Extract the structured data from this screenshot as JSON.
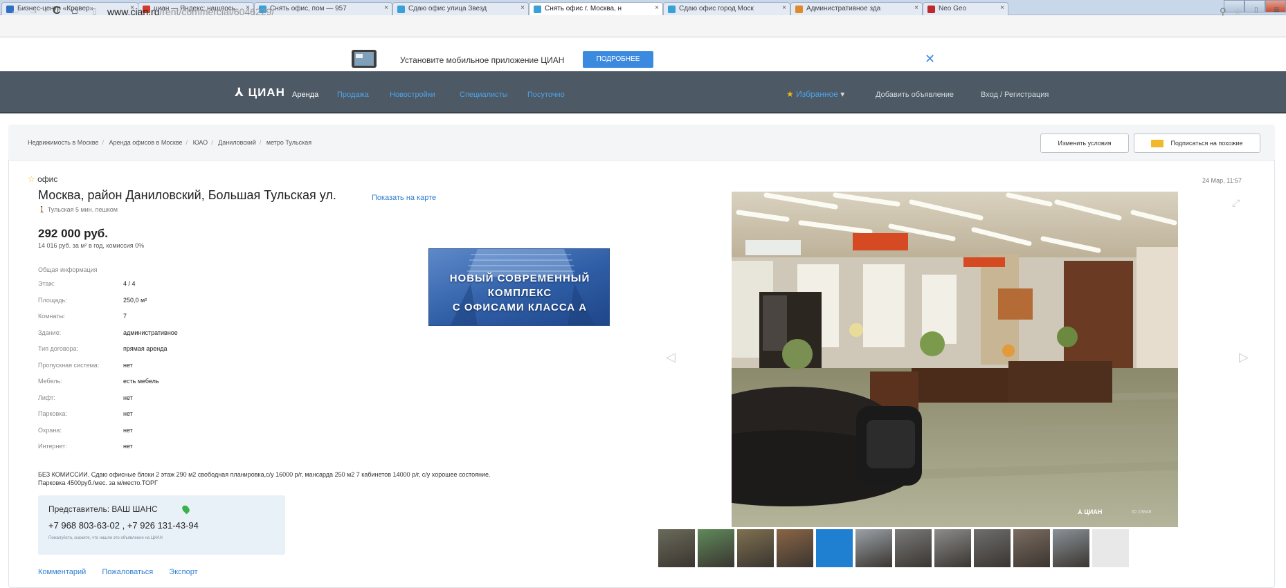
{
  "browser": {
    "tabs": [
      {
        "label": "Бизнес-центр «Кравер»",
        "color": "#2f6fc6",
        "active": false
      },
      {
        "label": "циан — Яндекс: нашлось",
        "color": "#d23a2a",
        "active": false
      },
      {
        "label": "Снять офис, пом — 957",
        "color": "#3aa0d8",
        "active": false
      },
      {
        "label": "Сдаю офис улица Звезд",
        "color": "#3aa0d8",
        "active": false
      },
      {
        "label": "Снять офис г. Москва, н",
        "color": "#3aa0d8",
        "active": true
      },
      {
        "label": "Сдаю офис город Моск",
        "color": "#3aa0d8",
        "active": false
      },
      {
        "label": "Административное зда",
        "color": "#e0892a",
        "active": false
      },
      {
        "label": "Neo Geo",
        "color": "#c0282a",
        "active": false
      }
    ],
    "url_host": "www.cian.ru",
    "url_path": "/rent/commercial/6046229/"
  },
  "promo": {
    "text": "Установите мобильное приложение ЦИАН",
    "button": "ПОДРОБНЕЕ",
    "close": "✕"
  },
  "header": {
    "logo": "ЦИАН",
    "nav_active": "Аренда",
    "nav": [
      "Продажа",
      "Новостройки",
      "Специалисты",
      "Посуточно"
    ],
    "favorites": "Избранное",
    "add_listing": "Добавить объявление",
    "login": "Вход / Регистрация"
  },
  "breadcrumbs": [
    "Недвижимость в Москве",
    "Аренда офисов в Москве",
    "ЮАО",
    "Даниловский",
    "метро Тульская"
  ],
  "buttons": {
    "change": "Изменить условия",
    "subscribe": "Подписаться на похожие"
  },
  "listing": {
    "type": "офис",
    "date": "24 Мар, 11:57",
    "address": "Москва, район Даниловский, Большая Тульская ул.",
    "map_link": "Показать на карте",
    "metro": "Тульская 5 мин. пешком",
    "price": "292 000 руб.",
    "price_sub": "14 016 руб. за м² в год, комиссия 0%",
    "info_title": "Общая информация",
    "rows": [
      {
        "k": "Этаж:",
        "v": "4 / 4"
      },
      {
        "k": "Площадь:",
        "v": "250,0 м²"
      },
      {
        "k": "Комнаты:",
        "v": "7"
      },
      {
        "k": "Здание:",
        "v": "административное"
      },
      {
        "k": "Тип договора:",
        "v": "прямая аренда"
      },
      {
        "k": "Пропускная система:",
        "v": "нет"
      },
      {
        "k": "Мебель:",
        "v": "есть мебель"
      },
      {
        "k": "Лифт:",
        "v": "нет"
      },
      {
        "k": "Парковка:",
        "v": "нет"
      },
      {
        "k": "Охрана:",
        "v": "нет"
      },
      {
        "k": "Интернет:",
        "v": "нет"
      }
    ],
    "description_1": "БЕЗ КОМИССИИ. Сдаю офисные блоки 2 этаж 290 м2 свободная планировка,с/у 16000 р/г, мансарда 250 м2 7 кабинетов 14000 р/г, с/у хорошее состояние.",
    "description_2": "Парковка 4500руб./мес. за м/место.ТОРГ"
  },
  "ad": {
    "line1": "НОВЫЙ СОВРЕМЕННЫЙ",
    "line2": "КОМПЛЕКС",
    "line3": "С ОФИСАМИ КЛАССА А"
  },
  "contact": {
    "label": "Представитель:",
    "name": "ВАШ ШАНС",
    "phones": "+7 968 803-63-02 , +7 926 131-43-94",
    "note": "Пожалуйста, скажите, что нашли это объявление на ЦИАН"
  },
  "actions": [
    "Комментарий",
    "Пожаловаться",
    "Экспорт"
  ],
  "photo": {
    "watermark": "ЦИАН",
    "id_text": "ID 15848",
    "thumb_colors": [
      "#6a6a5a",
      "#5f8a5a",
      "#7f7050",
      "#8a6545",
      "#1f7fd0",
      "#9aa2a8",
      "#7a7a7a",
      "#8c8c8c",
      "#6e6e6e",
      "#7c6c60",
      "#8a9298",
      "#e8e8e8"
    ]
  }
}
